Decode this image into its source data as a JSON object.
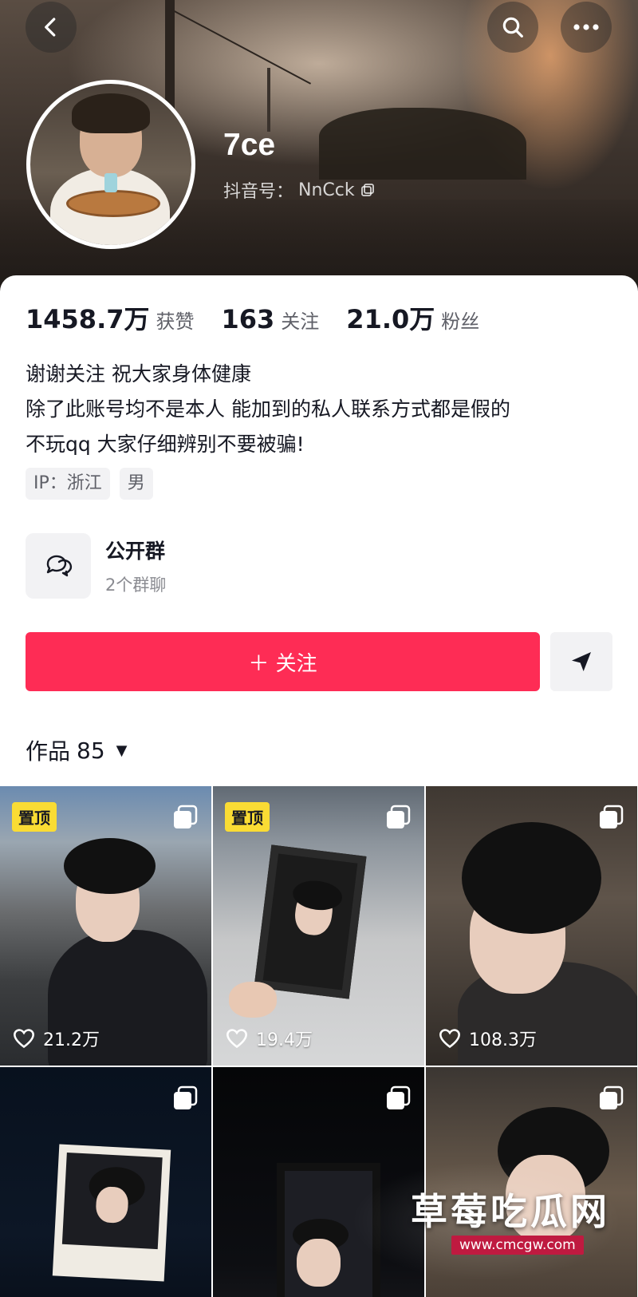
{
  "profile": {
    "username": "7ce",
    "douyin_id_label": "抖音号：",
    "douyin_id": "NnCck"
  },
  "stats": [
    {
      "value": "1458.7万",
      "label": "获赞"
    },
    {
      "value": "163",
      "label": "关注"
    },
    {
      "value": "21.0万",
      "label": "粉丝"
    }
  ],
  "bio": [
    "谢谢关注 祝大家身体健康",
    "除了此账号均不是本人 能加到的私人联系方式都是假的",
    "不玩qq 大家仔细辨别不要被骗!"
  ],
  "tags": {
    "ip": "IP：浙江",
    "gender": "男"
  },
  "group": {
    "title": "公开群",
    "subtitle": "2个群聊"
  },
  "actions": {
    "follow_label": "＋ 关注"
  },
  "works": {
    "label": "作品",
    "count": "85"
  },
  "videos": [
    {
      "pinned": "置顶",
      "likes": "21.2万"
    },
    {
      "pinned": "置顶",
      "likes": "19.4万"
    },
    {
      "pinned": "",
      "likes": "108.3万"
    },
    {
      "pinned": "",
      "likes": ""
    },
    {
      "pinned": "",
      "likes": ""
    },
    {
      "pinned": "",
      "likes": ""
    }
  ],
  "watermark": {
    "title": "草莓吃瓜网",
    "url": "www.cmcgw.com"
  },
  "colors": {
    "accent": "#fe2c55",
    "pin": "#fadc34"
  }
}
